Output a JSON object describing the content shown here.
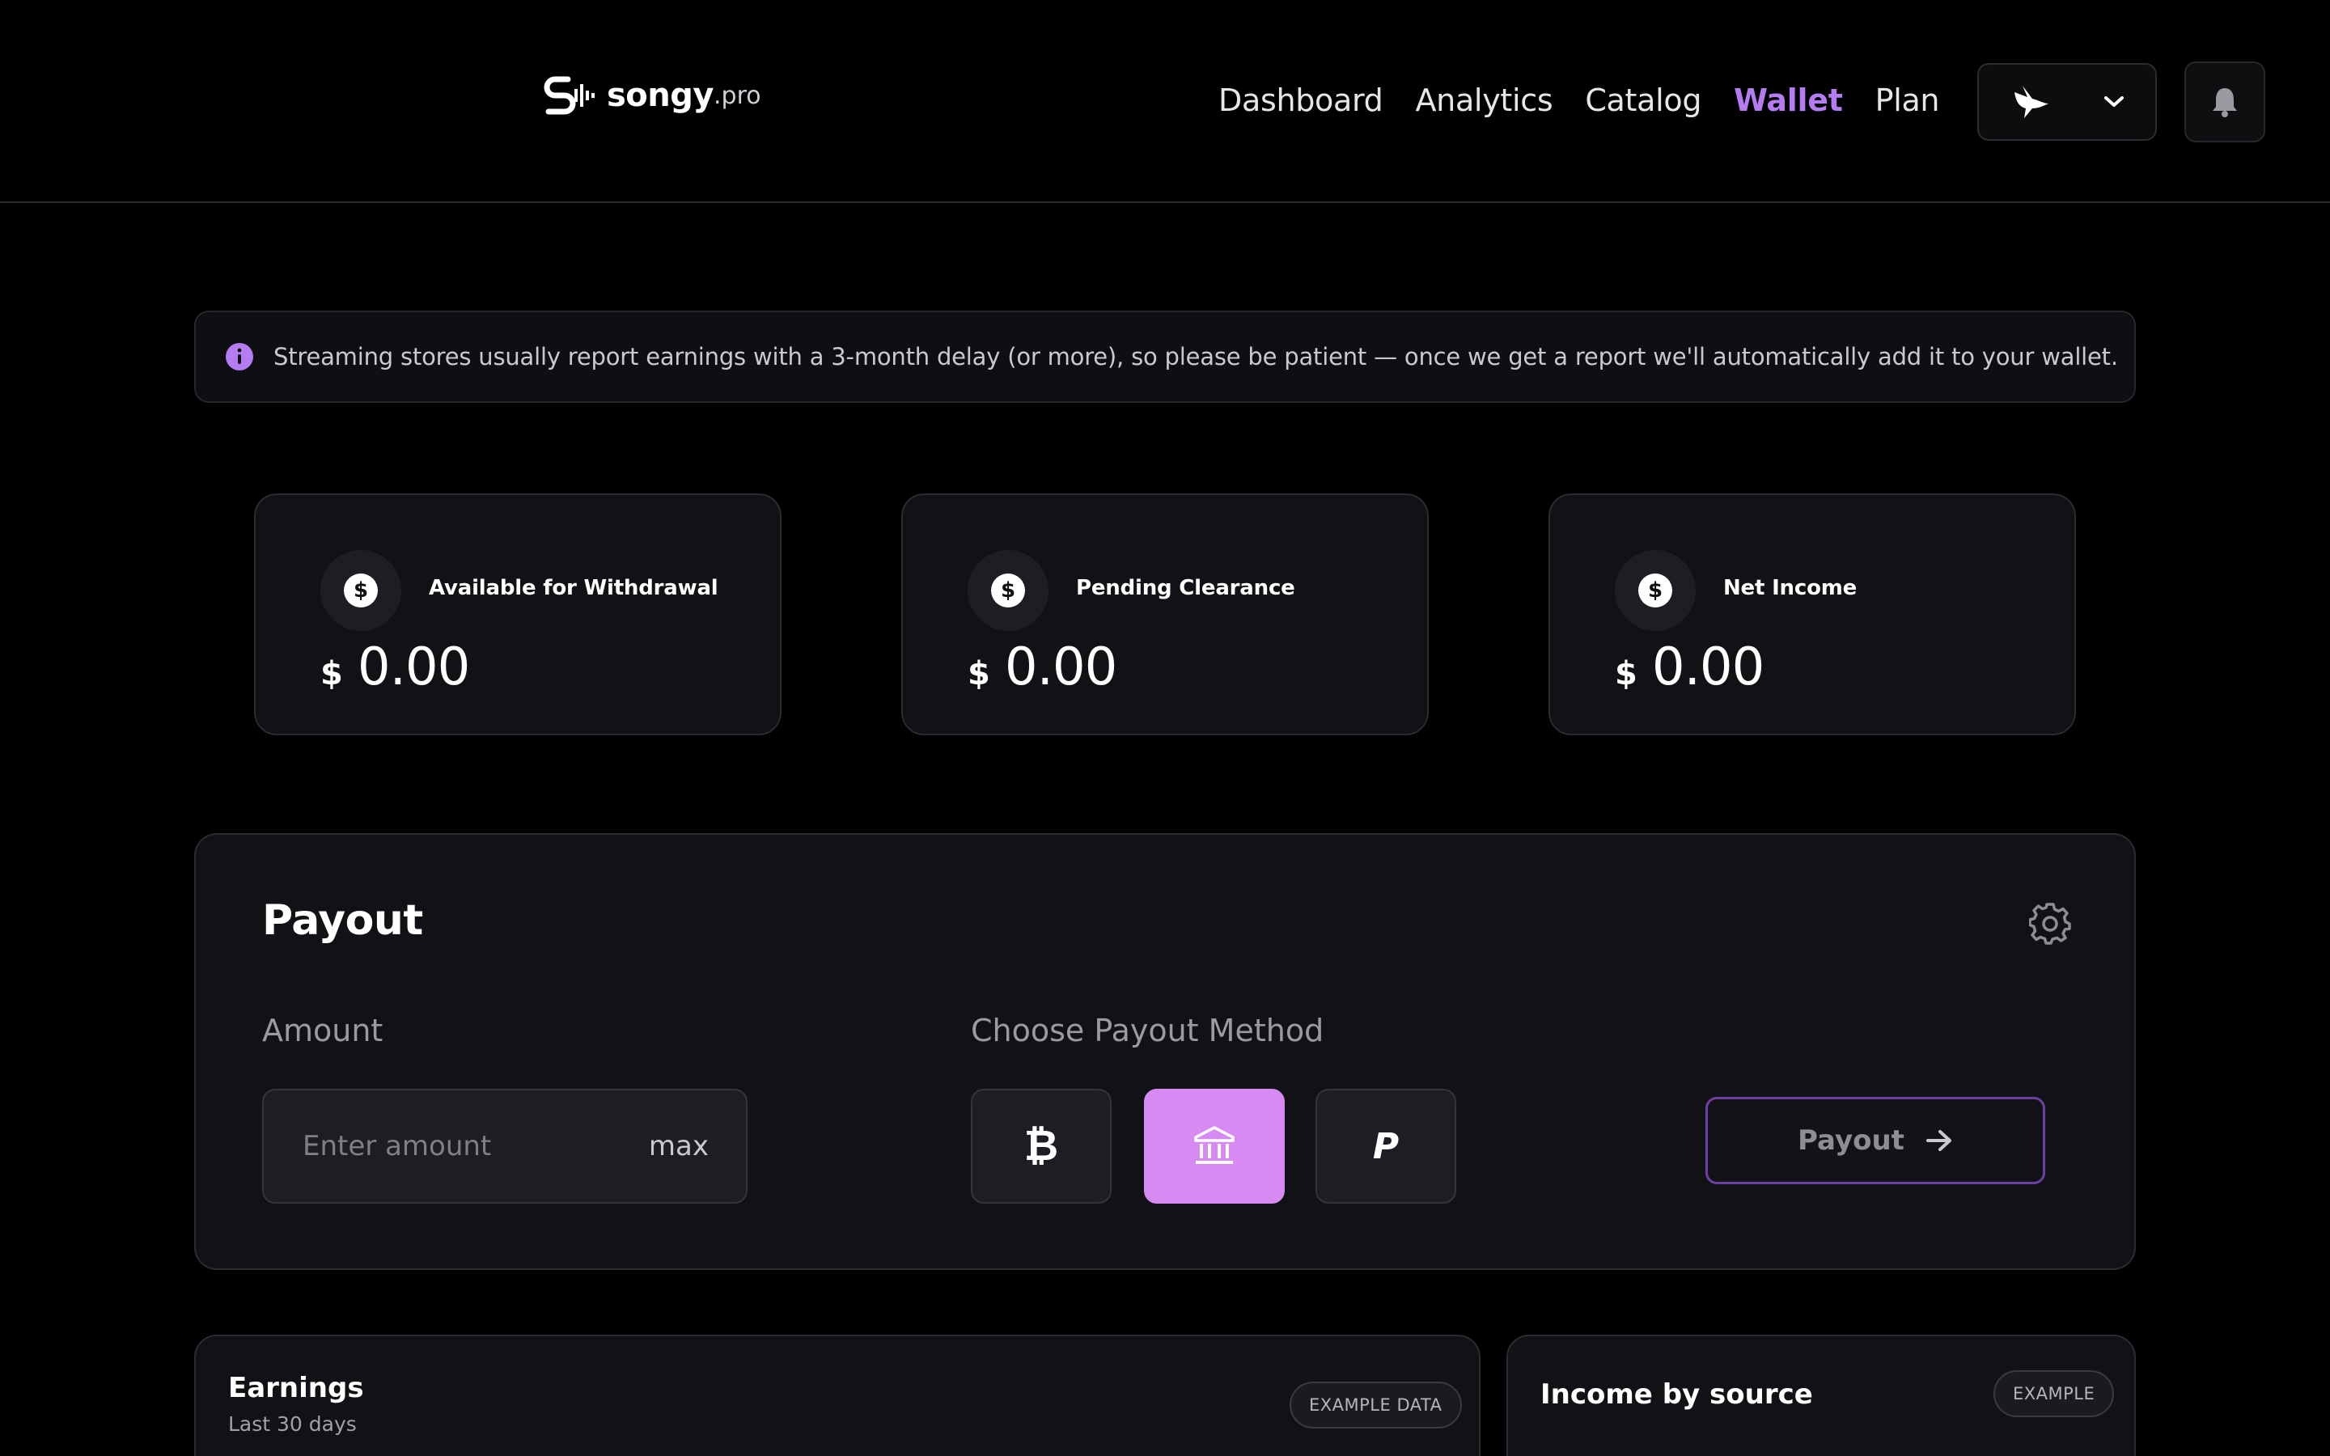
{
  "brand": {
    "name": "songy",
    "tld": ".pro"
  },
  "nav": {
    "items": [
      {
        "label": "Dashboard",
        "active": false
      },
      {
        "label": "Analytics",
        "active": false
      },
      {
        "label": "Catalog",
        "active": false
      },
      {
        "label": "Wallet",
        "active": true
      },
      {
        "label": "Plan",
        "active": false
      }
    ]
  },
  "header": {
    "profile_icon": "bird-icon",
    "bell_icon": "bell-icon"
  },
  "notice": {
    "icon": "info-icon",
    "text": "Streaming stores usually report earnings with a 3-month delay (or more), so please be patient — once we get a report we'll automatically add it to your wallet."
  },
  "stats": [
    {
      "label": "Available for Withdrawal",
      "currency": "$",
      "amount": "0.00",
      "icon": "dollar-icon"
    },
    {
      "label": "Pending Clearance",
      "currency": "$",
      "amount": "0.00",
      "icon": "dollar-icon"
    },
    {
      "label": "Net Income",
      "currency": "$",
      "amount": "0.00",
      "icon": "dollar-icon"
    }
  ],
  "payout": {
    "title": "Payout",
    "amount_label": "Amount",
    "amount_placeholder": "Enter amount",
    "amount_value": "",
    "max_label": "max",
    "method_label": "Choose Payout Method",
    "methods": [
      {
        "icon": "bitcoin-icon",
        "glyph": "₿",
        "selected": false
      },
      {
        "icon": "bank-icon",
        "glyph": "",
        "selected": true
      },
      {
        "icon": "paypal-icon",
        "glyph": "P",
        "selected": false
      }
    ],
    "button_label": "Payout",
    "accent": "#d78af2"
  },
  "earnings": {
    "title": "Earnings",
    "subtitle": "Last 30 days",
    "badge": "EXAMPLE DATA"
  },
  "income": {
    "title": "Income by source",
    "badge": "EXAMPLE"
  },
  "colors": {
    "active_nav": "#b57bf0",
    "notice_icon": "#b57bf0",
    "background": "#000000"
  }
}
